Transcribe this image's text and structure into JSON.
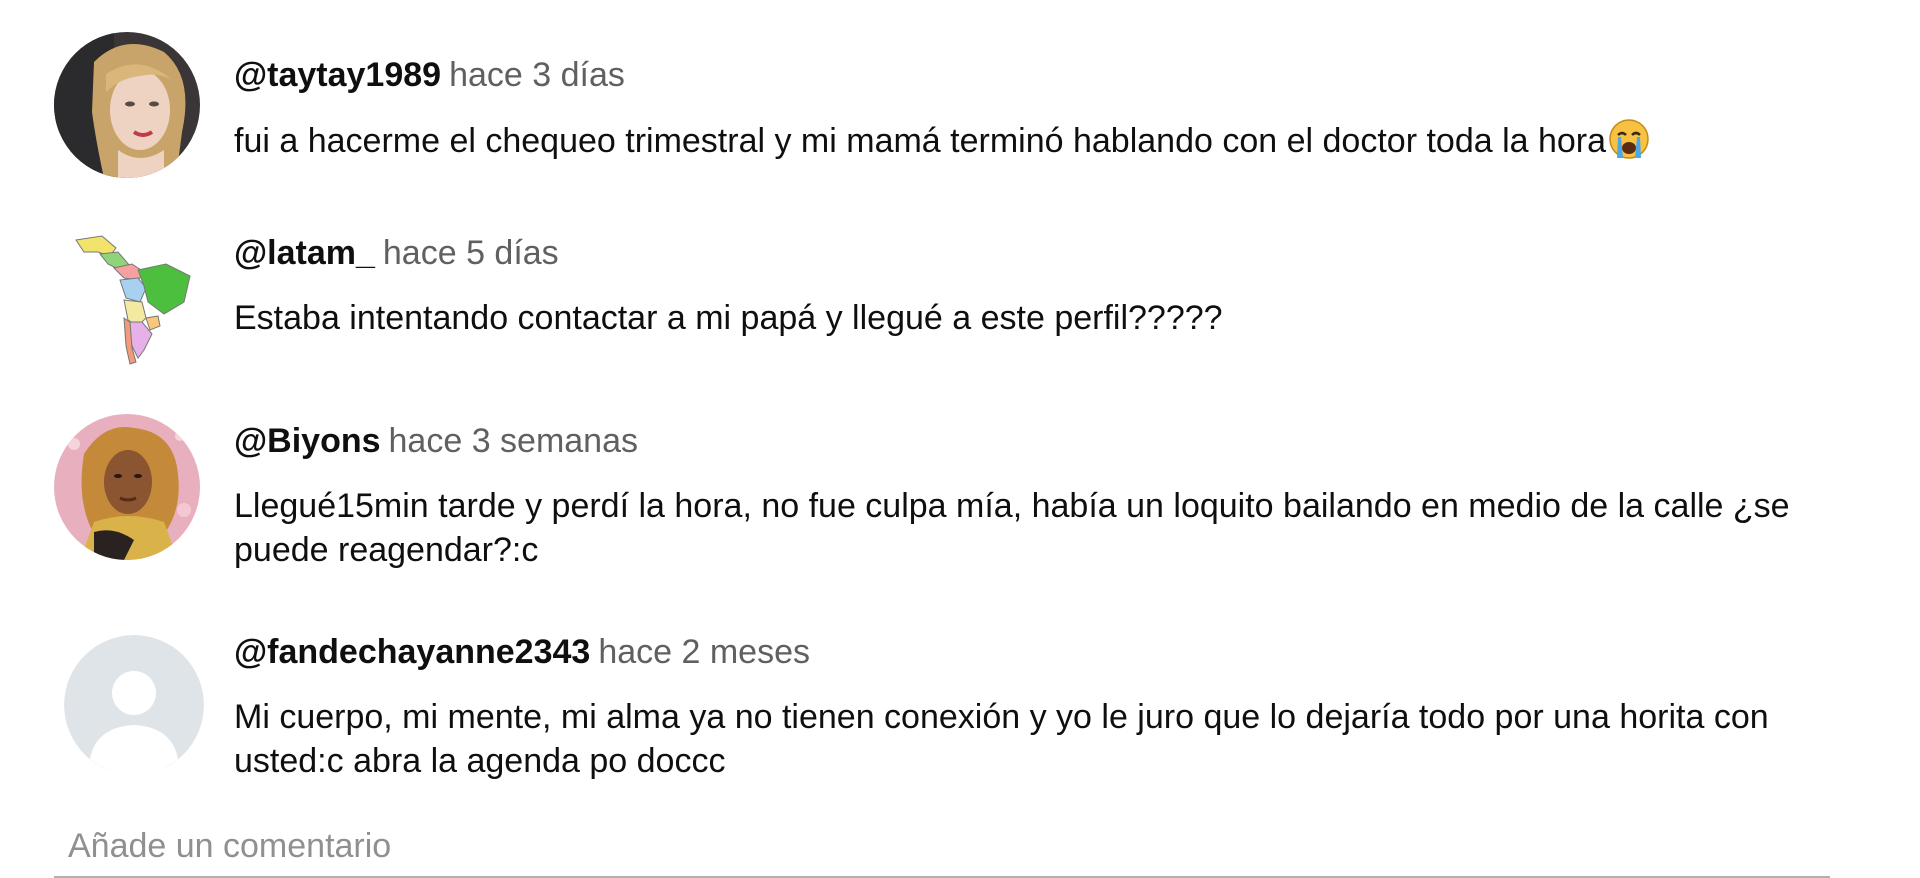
{
  "comments": [
    {
      "handle": "@taytay1989",
      "time": "hace 3 días",
      "text": "fui a hacerme el chequeo trimestral y mi mamá terminó hablando con el doctor toda la hora",
      "emoji": "crying-face-emoji"
    },
    {
      "handle": "@latam_",
      "time": "hace 5 días",
      "text": "Estaba intentando contactar a mi papá y llegué a este perfil?????"
    },
    {
      "handle": "@Biyons",
      "time": "hace 3 semanas",
      "text": "Llegué15min tarde y perdí la hora, no fue culpa mía, había un loquito bailando en medio de la calle ¿se puede reagendar?:c"
    },
    {
      "handle": "@fandechayanne2343",
      "time": "hace 2 meses",
      "text": "Mi cuerpo, mi mente, mi alma ya no tienen conexión y yo le juro que lo dejaría todo por una horita con usted:c abra la agenda po doccc"
    }
  ],
  "add_comment": {
    "placeholder": "Añade un comentario"
  },
  "colors": {
    "handle": "#0f0f0f",
    "time": "#606060",
    "placeholder": "#909090",
    "default_avatar_bg": "#dfe4e8",
    "default_avatar_fg": "#ffffff"
  }
}
